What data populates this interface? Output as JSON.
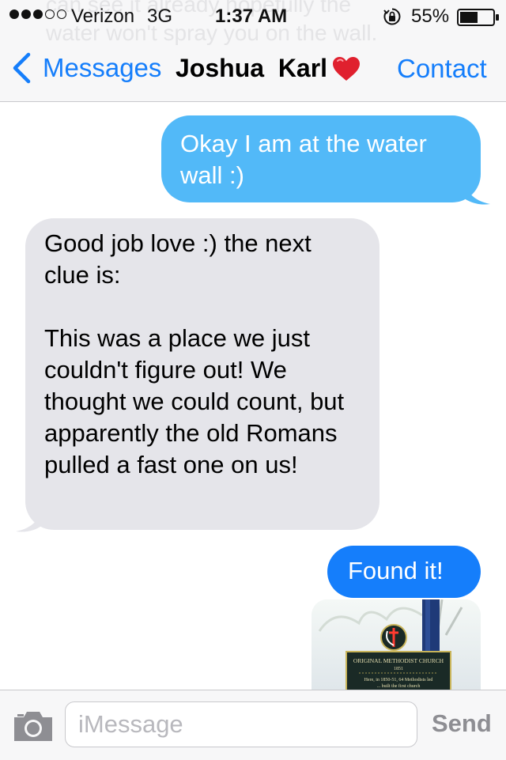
{
  "status_bar": {
    "carrier": "Verizon",
    "network": "3G",
    "time": "1:37 AM",
    "battery": "55%",
    "signal_bars": 3,
    "signal_max": 5,
    "battery_level": 0.55
  },
  "background_preview": {
    "text": "can see it already hopefully the water won't spray you on the wall."
  },
  "nav": {
    "back_label": "Messages",
    "title": "Joshua  Karl",
    "right_label": "Contact"
  },
  "messages": [
    {
      "direction": "outgoing",
      "kind": "imessage",
      "text": "Okay I am at the water wall :)"
    },
    {
      "direction": "incoming",
      "text": "Good job love :) the next clue is:\n\nThis was a place we just couldn't figure out! We thought we could count, but apparently the old Romans pulled a fast one on us!"
    },
    {
      "direction": "outgoing",
      "kind": "sms",
      "text": "Found it!"
    }
  ],
  "photo": {
    "sign_title": "ORIGINAL METHODIST CHURCH",
    "sign_year": "1851",
    "sign_line": "Here, in 1850-51, 64 Methodists led",
    "sign_line2": "... built the first church"
  },
  "input_bar": {
    "placeholder": "iMessage",
    "send_label": "Send"
  },
  "colors": {
    "ios_blue": "#157efb",
    "imessage_bubble": "#52b9f8",
    "incoming_bubble": "#e5e5ea",
    "heart": "#e0202e"
  }
}
